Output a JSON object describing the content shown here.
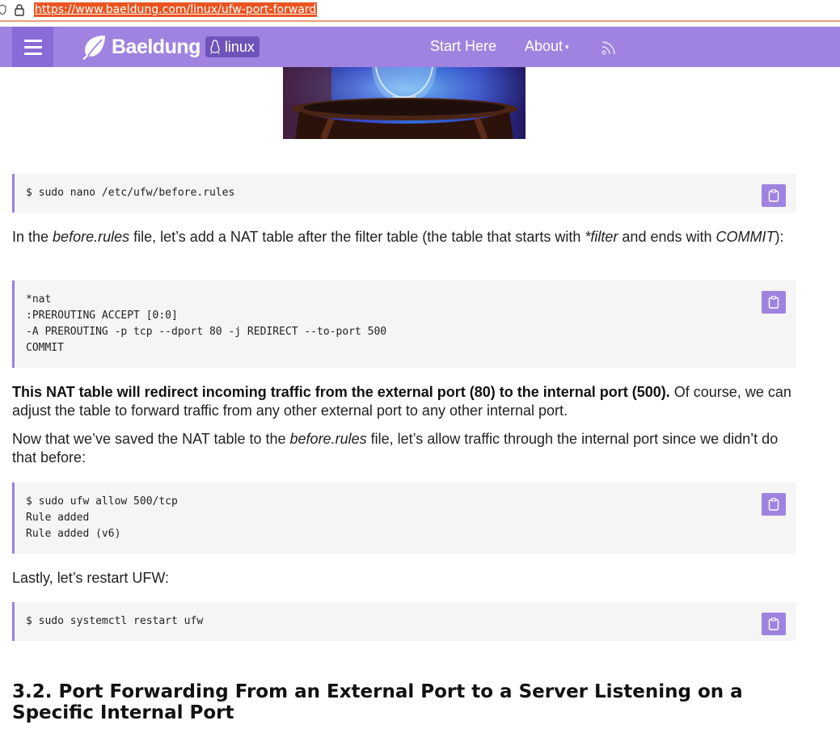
{
  "browser": {
    "url": "https://www.baeldung.com/linux/ufw-port-forward"
  },
  "nav": {
    "brand": "Baeldung",
    "tag": "linux",
    "links": [
      "Start Here",
      "About"
    ],
    "icons": [
      "menu-icon",
      "leaf-logo-icon",
      "penguin-icon",
      "chevron-down-icon",
      "rss-icon"
    ],
    "accent_color": "#a083e0"
  },
  "article": {
    "code1": [
      "$ sudo nano /etc/ufw/before.rules"
    ],
    "para1": {
      "t1": "In the ",
      "em1": "before.rules",
      "t2": " file, let’s add a NAT table after the filter table (the table that starts with ",
      "em2": "*filter",
      "t3": " and ends with ",
      "em3": "COMMIT",
      "t4": "):"
    },
    "code2": [
      "*nat",
      ":PREROUTING ACCEPT [0:0]",
      "-A PREROUTING -p tcp --dport 80 -j REDIRECT --to-port 500",
      "COMMIT"
    ],
    "para2": {
      "bold": "This NAT table will redirect incoming traffic from the external port (80) to the internal port (500).",
      "rest": " Of course, we can adjust the table to forward traffic from any other external port to any other internal port."
    },
    "para3": {
      "t1": "Now that we’ve saved the NAT table to the ",
      "em1": "before.rules",
      "t2": " file, let’s allow traffic through the internal port since we didn’t do that before:"
    },
    "code3": [
      "$ sudo ufw allow 500/tcp",
      "Rule added",
      "Rule added (v6)"
    ],
    "para4": "Lastly, let’s restart UFW:",
    "code4": [
      "$ sudo systemctl restart ufw"
    ],
    "heading": "3.2. Port Forwarding From an External Port to a Server Listening on a Specific Internal Port",
    "copy_icon": "clipboard-icon"
  }
}
